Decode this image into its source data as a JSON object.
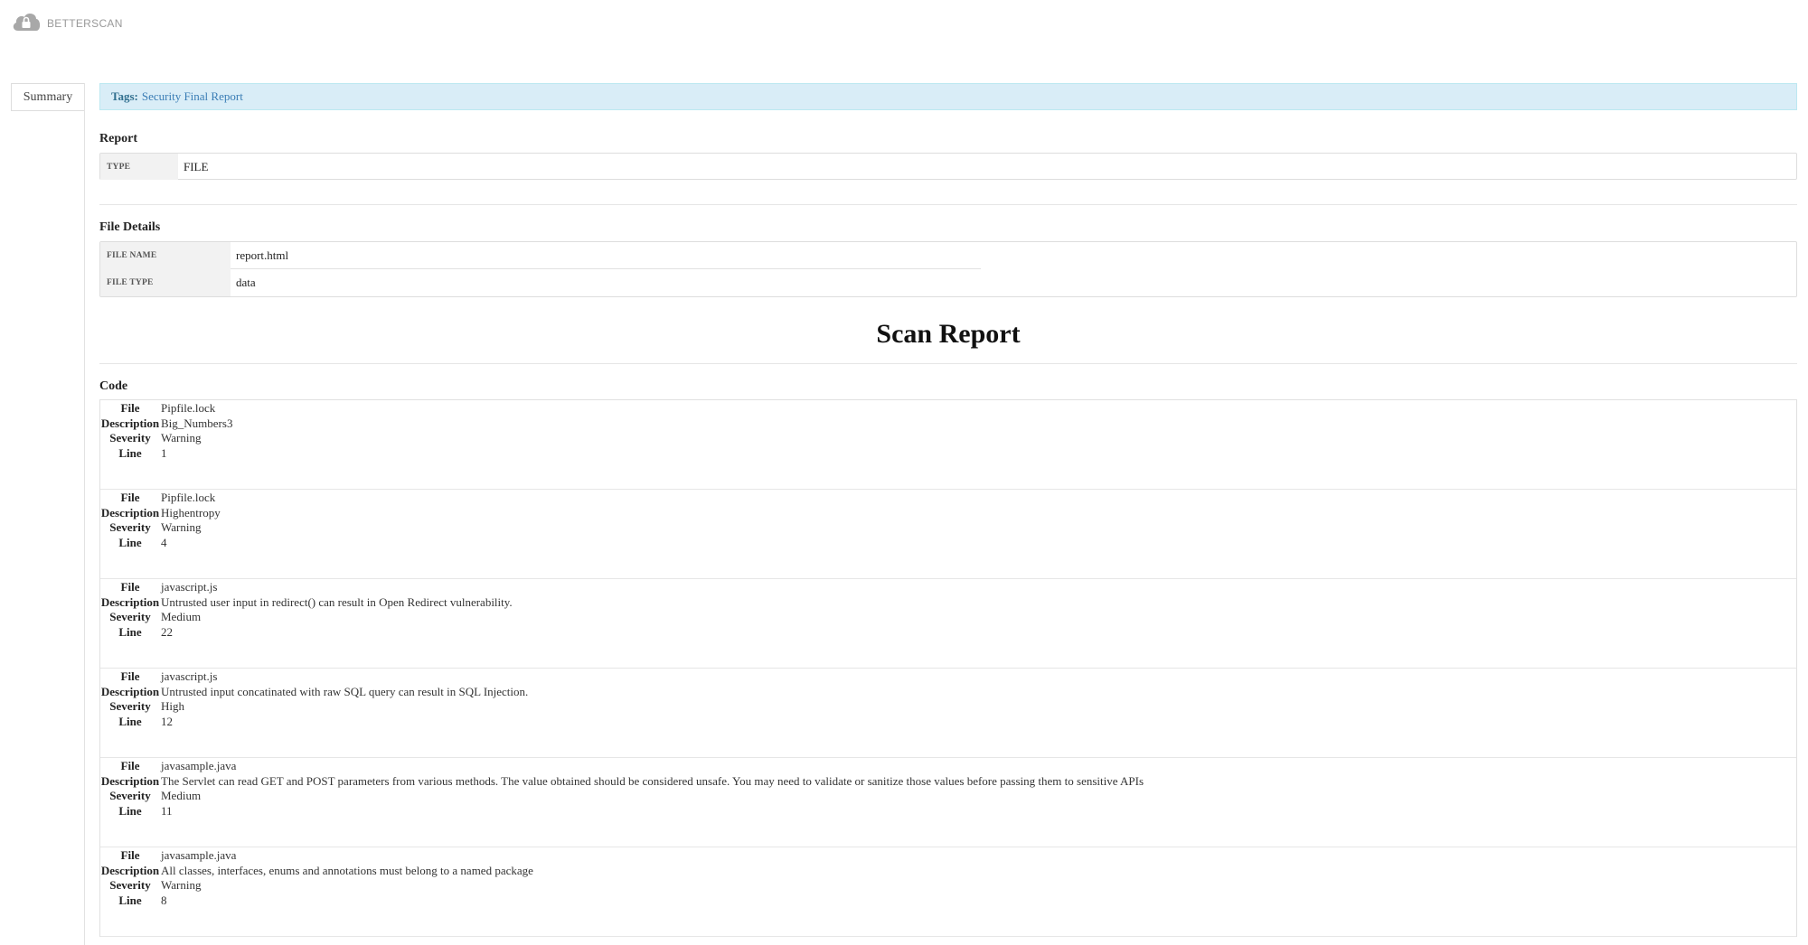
{
  "brand": {
    "name": "BETTERSCAN"
  },
  "sidebar": {
    "tabs": [
      {
        "label": "Summary"
      }
    ]
  },
  "tags": {
    "label": "Tags:",
    "value": "Security Final Report"
  },
  "report": {
    "title": "Report",
    "rows": [
      {
        "key": "TYPE",
        "value": "FILE"
      }
    ]
  },
  "file_details": {
    "title": "File Details",
    "rows": [
      {
        "key": "FILE NAME",
        "value": "report.html"
      },
      {
        "key": "FILE TYPE",
        "value": "data"
      }
    ]
  },
  "scan_report": {
    "title": "Scan Report"
  },
  "code": {
    "title": "Code",
    "labels": {
      "file": "File",
      "description": "Description",
      "severity": "Severity",
      "line": "Line"
    },
    "findings": [
      {
        "file": "Pipfile.lock",
        "description": "Big_Numbers3",
        "severity": "Warning",
        "line": "1"
      },
      {
        "file": "Pipfile.lock",
        "description": "Highentropy",
        "severity": "Warning",
        "line": "4"
      },
      {
        "file": "javascript.js",
        "description": "Untrusted user input in redirect() can result in Open Redirect vulnerability.",
        "severity": "Medium",
        "line": "22"
      },
      {
        "file": "javascript.js",
        "description": "Untrusted input concatinated with raw SQL query can result in SQL Injection.",
        "severity": "High",
        "line": "12"
      },
      {
        "file": "javasample.java",
        "description": "The Servlet can read GET and POST parameters from various methods. The value obtained should be considered unsafe. You may need to validate or sanitize those values before passing them to sensitive APIs",
        "severity": "Medium",
        "line": "11"
      },
      {
        "file": "javasample.java",
        "description": "All classes, interfaces, enums and annotations must belong to a named package",
        "severity": "Warning",
        "line": "8"
      }
    ]
  },
  "colors": {
    "info_bg": "#d9edf7",
    "info_text": "#31708f",
    "key_bg": "#f2f2f2"
  },
  "icons": {
    "logo": "cloud-lock-icon"
  }
}
